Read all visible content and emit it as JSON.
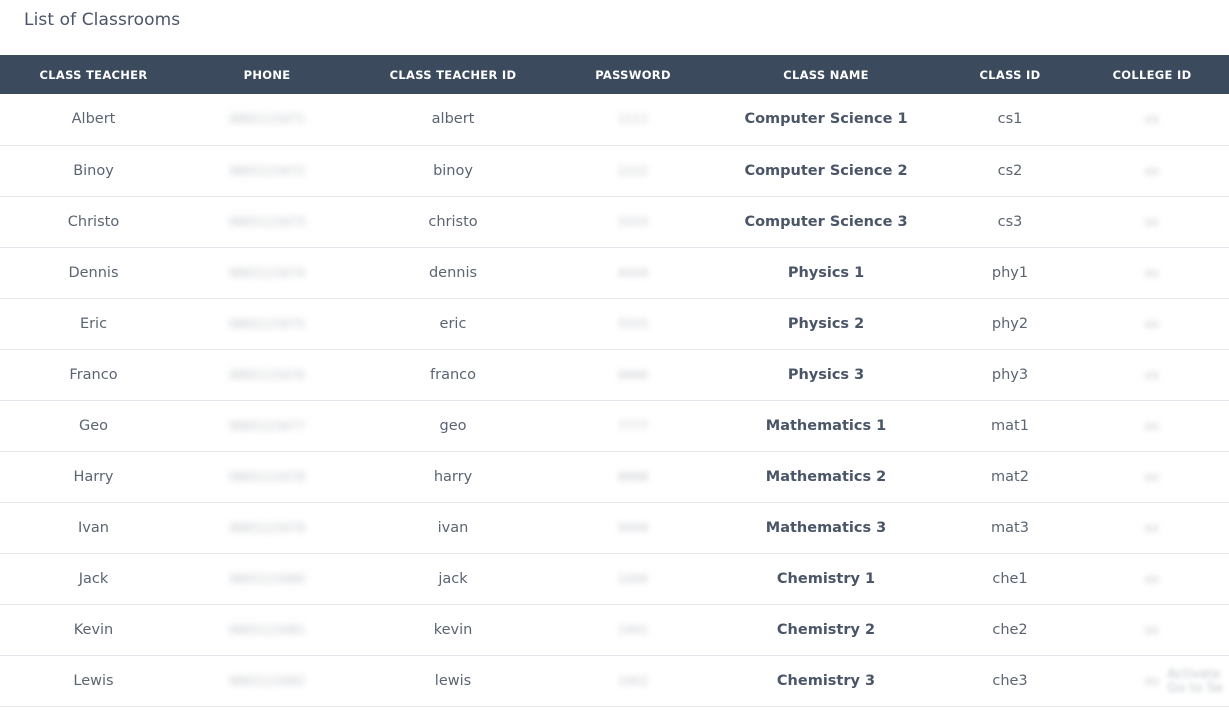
{
  "page": {
    "title": "List of Classrooms"
  },
  "table": {
    "columns": [
      "CLASS TEACHER",
      "PHONE",
      "CLASS TEACHER ID",
      "PASSWORD",
      "CLASS NAME",
      "CLASS ID",
      "COLLEGE ID"
    ],
    "rows": [
      {
        "teacher": "Albert",
        "phone": "9865123471",
        "teacher_id": "albert",
        "password": "1111",
        "class_name": "Computer Science 1",
        "class_id": "cs1",
        "college_id": "ex"
      },
      {
        "teacher": "Binoy",
        "phone": "9865123472",
        "teacher_id": "binoy",
        "password": "2222",
        "class_name": "Computer Science 2",
        "class_id": "cs2",
        "college_id": "ex"
      },
      {
        "teacher": "Christo",
        "phone": "9865123473",
        "teacher_id": "christo",
        "password": "3333",
        "class_name": "Computer Science 3",
        "class_id": "cs3",
        "college_id": "ex"
      },
      {
        "teacher": "Dennis",
        "phone": "9865123474",
        "teacher_id": "dennis",
        "password": "4444",
        "class_name": "Physics 1",
        "class_id": "phy1",
        "college_id": "ex"
      },
      {
        "teacher": "Eric",
        "phone": "9865123475",
        "teacher_id": "eric",
        "password": "5555",
        "class_name": "Physics 2",
        "class_id": "phy2",
        "college_id": "ex"
      },
      {
        "teacher": "Franco",
        "phone": "9865123476",
        "teacher_id": "franco",
        "password": "6666",
        "class_name": "Physics 3",
        "class_id": "phy3",
        "college_id": "ex"
      },
      {
        "teacher": "Geo",
        "phone": "9865123477",
        "teacher_id": "geo",
        "password": "7777",
        "class_name": "Mathematics 1",
        "class_id": "mat1",
        "college_id": "ex"
      },
      {
        "teacher": "Harry",
        "phone": "9865123478",
        "teacher_id": "harry",
        "password": "8888",
        "class_name": "Mathematics 2",
        "class_id": "mat2",
        "college_id": "ex"
      },
      {
        "teacher": "Ivan",
        "phone": "9865123479",
        "teacher_id": "ivan",
        "password": "9999",
        "class_name": "Mathematics 3",
        "class_id": "mat3",
        "college_id": "ex"
      },
      {
        "teacher": "Jack",
        "phone": "9865123480",
        "teacher_id": "jack",
        "password": "1000",
        "class_name": "Chemistry 1",
        "class_id": "che1",
        "college_id": "ex"
      },
      {
        "teacher": "Kevin",
        "phone": "9865123481",
        "teacher_id": "kevin",
        "password": "1001",
        "class_name": "Chemistry 2",
        "class_id": "che2",
        "college_id": "ex"
      },
      {
        "teacher": "Lewis",
        "phone": "9865123482",
        "teacher_id": "lewis",
        "password": "1002",
        "class_name": "Chemistry 3",
        "class_id": "che3",
        "college_id": "ex"
      }
    ]
  },
  "watermark": {
    "line1": "Activate",
    "line2": "Go to Se"
  },
  "colors": {
    "header_bg": "#3b4a5d",
    "header_text": "#ffffff",
    "row_border": "#e3e6ea",
    "text": "#5b6472"
  }
}
